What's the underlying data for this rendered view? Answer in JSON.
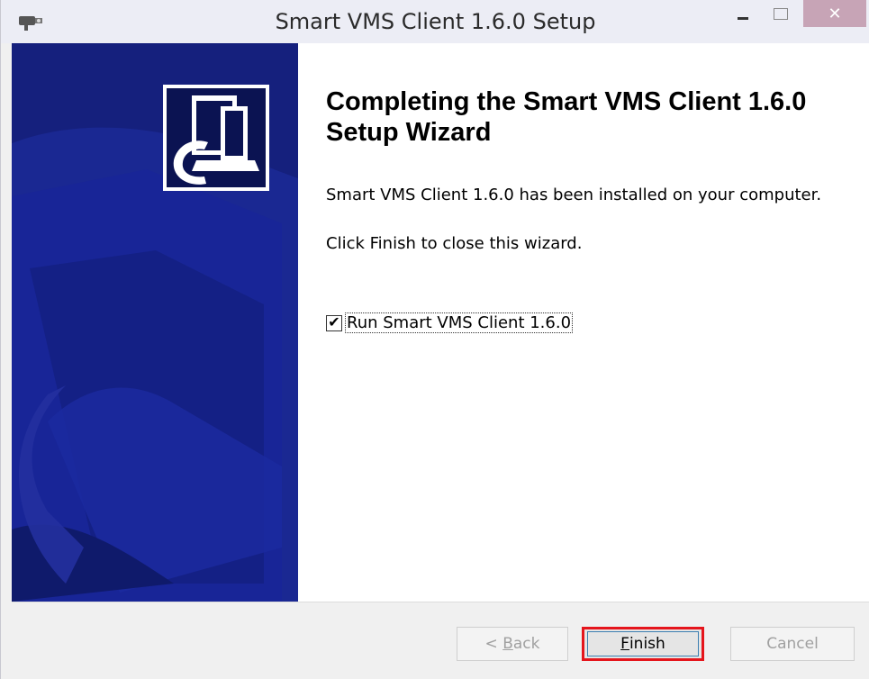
{
  "window": {
    "title": "Smart VMS Client 1.6.0 Setup",
    "close_glyph": "✕",
    "app_icon": "camera-icon"
  },
  "wizard": {
    "heading": "Completing the Smart VMS Client 1.6.0 Setup Wizard",
    "installed_text": "Smart VMS Client 1.6.0 has been installed on your computer.",
    "finish_hint": "Click Finish to close this wizard.",
    "run_checkbox": {
      "label": "Run Smart VMS Client 1.6.0",
      "checked": true,
      "mark": "✔"
    }
  },
  "buttons": {
    "back_prefix": "< ",
    "back_access_key": "B",
    "back_rest": "ack",
    "finish_access_key": "F",
    "finish_rest": "inish",
    "cancel": "Cancel"
  },
  "colors": {
    "banner": "#15207d",
    "highlight": "#e5151c"
  }
}
